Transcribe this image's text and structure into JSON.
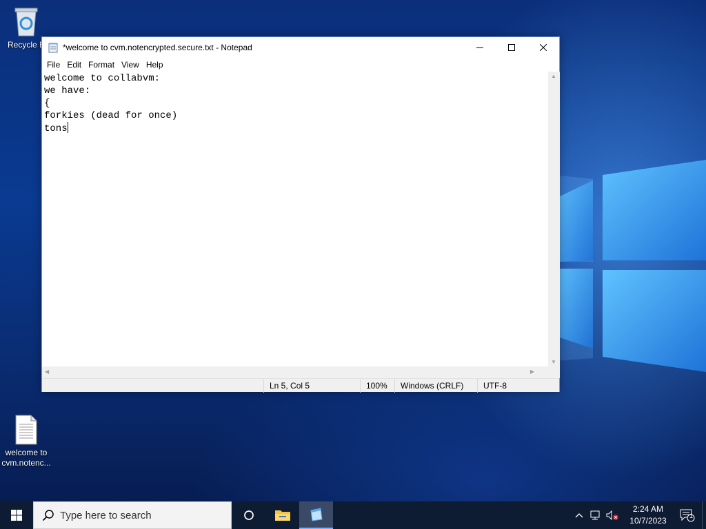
{
  "desktop": {
    "icons": [
      {
        "label": "Recycle Bin",
        "visible_label": "Recycle B",
        "icon": "recycle-bin-icon"
      },
      {
        "label_line1": "welcome to",
        "label_line2": "cvm.notenc...",
        "icon": "text-file-icon"
      }
    ]
  },
  "notepad": {
    "title": "*welcome to cvm.notencrypted.secure.txt - Notepad",
    "menu": [
      "File",
      "Edit",
      "Format",
      "View",
      "Help"
    ],
    "content_lines": [
      "welcome to collabvm:",
      "we have:",
      "{",
      "forkies (dead for once)",
      "tons"
    ],
    "status": {
      "position": "Ln 5, Col 5",
      "zoom": "100%",
      "line_endings": "Windows (CRLF)",
      "encoding": "UTF-8"
    }
  },
  "taskbar": {
    "search_placeholder": "Type here to search",
    "clock_time": "2:24 AM",
    "clock_date": "10/7/2023",
    "notification_count": "1",
    "accent_color": "#7fb0ff"
  }
}
